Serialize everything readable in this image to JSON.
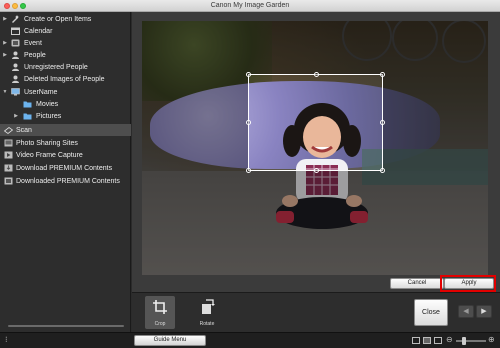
{
  "window": {
    "title": "Canon My Image Garden"
  },
  "sidebar": {
    "items": [
      {
        "label": "Create or Open Items",
        "icon": "create-icon",
        "expandable": true,
        "indent": 0
      },
      {
        "label": "Calendar",
        "icon": "calendar-icon",
        "expandable": false,
        "indent": 0
      },
      {
        "label": "Event",
        "icon": "event-icon",
        "expandable": true,
        "indent": 0
      },
      {
        "label": "People",
        "icon": "people-icon",
        "expandable": true,
        "indent": 0
      },
      {
        "label": "Unregistered People",
        "icon": "person-icon",
        "expandable": false,
        "indent": 0
      },
      {
        "label": "Deleted Images of People",
        "icon": "person-icon",
        "expandable": false,
        "indent": 0
      },
      {
        "label": "UserName",
        "icon": "computer-icon",
        "expandable": true,
        "expanded": true,
        "indent": 0
      },
      {
        "label": "Movies",
        "icon": "folder-icon",
        "expandable": false,
        "indent": 1
      },
      {
        "label": "Pictures",
        "icon": "folder-icon",
        "expandable": true,
        "indent": 1
      },
      {
        "label": "Scan",
        "icon": "scan-icon",
        "expandable": false,
        "indent": 0,
        "selected": true
      },
      {
        "label": "Photo Sharing Sites",
        "icon": "photo-share-icon",
        "expandable": false,
        "indent": 0
      },
      {
        "label": "Video Frame Capture",
        "icon": "video-frame-icon",
        "expandable": false,
        "indent": 0
      },
      {
        "label": "Download PREMIUM Contents",
        "icon": "download-icon",
        "expandable": false,
        "indent": 0
      },
      {
        "label": "Downloaded PREMIUM Contents",
        "icon": "downloaded-icon",
        "expandable": false,
        "indent": 0
      }
    ]
  },
  "editor": {
    "cancel_label": "Cancel",
    "apply_label": "Apply"
  },
  "toolbar": {
    "tools": [
      {
        "label": "Crop",
        "icon": "crop-icon",
        "selected": true
      },
      {
        "label": "Rotate",
        "icon": "rotate-icon",
        "selected": false
      }
    ],
    "close_label": "Close",
    "prev_icon": "prev-arrow-icon",
    "next_icon": "next-arrow-icon"
  },
  "statusbar": {
    "guide_menu_label": "Guide Menu"
  },
  "colors": {
    "highlight": "#e20000",
    "sidebar_bg": "#2d2d2d",
    "selected_bg": "#4e4e4e"
  }
}
